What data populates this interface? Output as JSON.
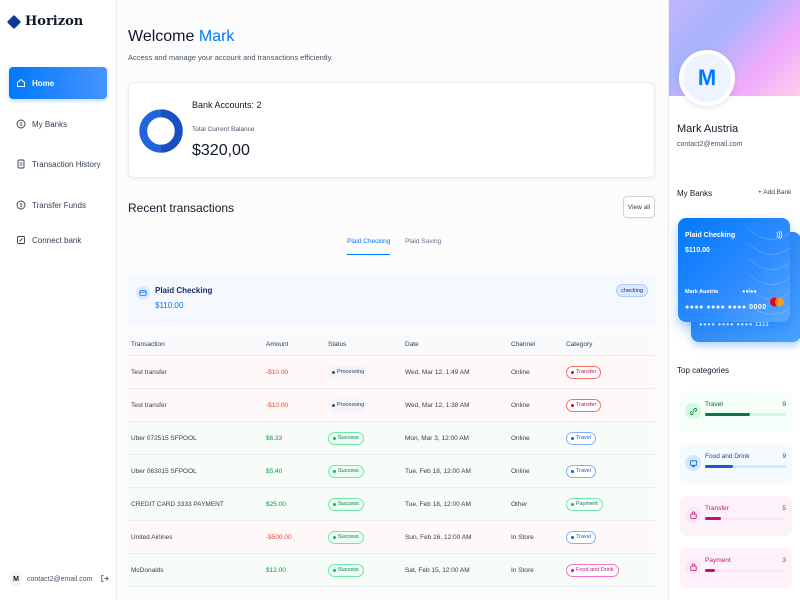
{
  "app": {
    "name": "Horizon"
  },
  "colors": {
    "accent": "#0179fe",
    "brand_dark": "#0b3b91",
    "success": "#039855",
    "danger": "#f04438"
  },
  "sidebar": {
    "items": [
      {
        "label": "Home",
        "icon": "home-icon",
        "active": true
      },
      {
        "label": "My Banks",
        "icon": "dollar-icon",
        "active": false
      },
      {
        "label": "Transaction History",
        "icon": "receipt-icon",
        "active": false
      },
      {
        "label": "Transfer Funds",
        "icon": "money-transfer-icon",
        "active": false
      },
      {
        "label": "Connect bank",
        "icon": "link-icon",
        "active": false
      }
    ],
    "footer": {
      "avatar_initial": "M",
      "email": "contact2@email.com"
    }
  },
  "header": {
    "greeting": "Welcome",
    "user_first_name": "Mark",
    "subtitle": "Access and manage your account and transactions efficiently."
  },
  "balance": {
    "accounts_label": "Bank Accounts: 2",
    "total_label": "Total Current Balance",
    "total_value": "$320,00"
  },
  "recent": {
    "title": "Recent transactions",
    "view_all": "View all",
    "tabs": [
      {
        "label": "Plaid Checking",
        "active": true
      },
      {
        "label": "Plaid Saving",
        "active": false
      }
    ],
    "bank": {
      "name": "Plaid Checking",
      "balance": "$110.00",
      "tag": "checking"
    }
  },
  "table": {
    "headers": [
      "Transaction",
      "Amount",
      "Status",
      "Date",
      "Channel",
      "Category"
    ],
    "rows": [
      {
        "name": "Test transfer",
        "amount": "-$10.00",
        "type": "debit",
        "status": "Processing",
        "date": "Wed, Mar 12, 1:49 AM",
        "channel": "Online",
        "category": "Transfer"
      },
      {
        "name": "Test transfer",
        "amount": "-$10.00",
        "type": "debit",
        "status": "Processing",
        "date": "Wed, Mar 12, 1:38 AM",
        "channel": "Online",
        "category": "Transfer"
      },
      {
        "name": "Uber 072515 SFPOOL",
        "amount": "$6.33",
        "type": "credit",
        "status": "Success",
        "date": "Mon, Mar 3, 12:00 AM",
        "channel": "Online",
        "category": "Travel"
      },
      {
        "name": "Uber 063015 SFPOOL",
        "amount": "$5.40",
        "type": "credit",
        "status": "Success",
        "date": "Tue, Feb 18, 12:00 AM",
        "channel": "Online",
        "category": "Travel"
      },
      {
        "name": "CREDIT CARD 3333 PAYMENT",
        "amount": "$25.00",
        "type": "credit",
        "status": "Success",
        "date": "Tue, Feb 18, 12:00 AM",
        "channel": "Other",
        "category": "Payment"
      },
      {
        "name": "United Airlines",
        "amount": "-$500.00",
        "type": "debit",
        "status": "Success",
        "date": "Sun, Feb 16, 12:00 AM",
        "channel": "In Store",
        "category": "Travel"
      },
      {
        "name": "McDonalds",
        "amount": "$12.00",
        "type": "credit",
        "status": "Success",
        "date": "Sat, Feb 15, 12:00 AM",
        "channel": "In Store",
        "category": "Food and Drink"
      }
    ]
  },
  "profile": {
    "initial": "M",
    "name": "Mark Austria",
    "email": "contact2@email.com",
    "my_banks_title": "My Banks",
    "add_bank": "+ Add Bank"
  },
  "card": {
    "title": "Plaid Checking",
    "balance": "$110.00",
    "holder": "Mark Austria",
    "expiry": "●●/●●",
    "number": "●●●● ●●●● ●●●● 0000",
    "back_number": "●●●● ●●●● ●●●● 1111"
  },
  "top_categories": {
    "title": "Top categories",
    "items": [
      {
        "name": "Travel",
        "count": "9",
        "fill": 0.55,
        "bg": "#f6fef9",
        "bar_bg": "#d1fadf",
        "bar_fill": "#027a48",
        "text": "#05603a",
        "icon": "link-icon",
        "icon_bg": "#d1fadf"
      },
      {
        "name": "Food and Drink",
        "count": "9",
        "fill": 0.35,
        "bg": "#f5faff",
        "bar_bg": "#d1e9ff",
        "bar_fill": "#175cd3",
        "text": "#194185",
        "icon": "monitor-icon",
        "icon_bg": "#d1e9ff"
      },
      {
        "name": "Transfer",
        "count": "5",
        "fill": 0.2,
        "bg": "#fdf2fa",
        "bar_bg": "#fce7f6",
        "bar_fill": "#c11574",
        "text": "#c11574",
        "icon": "bag-icon",
        "icon_bg": "#fce7f6"
      },
      {
        "name": "Payment",
        "count": "3",
        "fill": 0.12,
        "bg": "#fdf2fa",
        "bar_bg": "#fce7f6",
        "bar_fill": "#c11574",
        "text": "#c11574",
        "icon": "bag-icon",
        "icon_bg": "#fce7f6"
      }
    ]
  }
}
